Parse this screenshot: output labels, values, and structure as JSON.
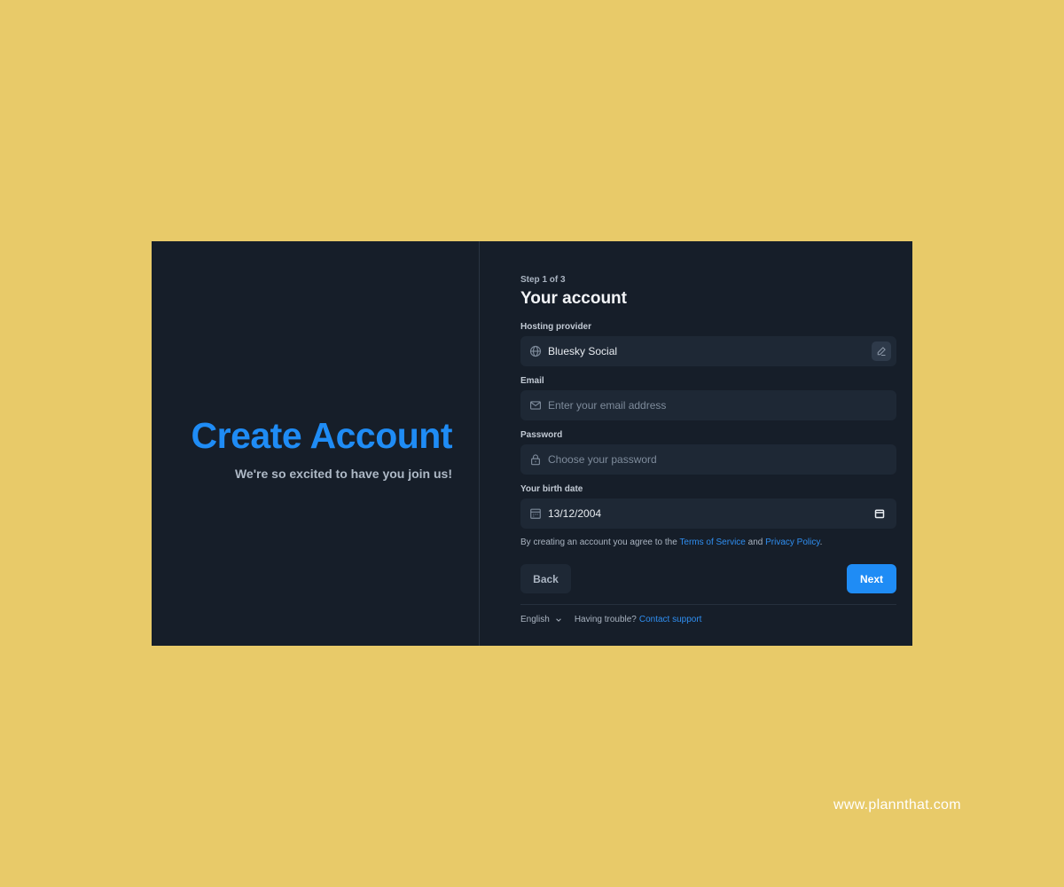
{
  "hero": {
    "title": "Create Account",
    "subtitle": "We're so excited to have you join us!"
  },
  "form": {
    "step": "Step 1 of 3",
    "title": "Your account",
    "hosting_provider": {
      "label": "Hosting provider",
      "value": "Bluesky Social",
      "icon": "globe-icon",
      "action_icon": "pencil-icon"
    },
    "email": {
      "label": "Email",
      "placeholder": "Enter your email address",
      "icon": "envelope-icon"
    },
    "password": {
      "label": "Password",
      "placeholder": "Choose your password",
      "icon": "lock-icon"
    },
    "birth_date": {
      "label": "Your birth date",
      "value": "13/12/2004",
      "icon": "calendar-icon"
    },
    "terms": {
      "prefix": "By creating an account you agree to the ",
      "tos_link": "Terms of Service",
      "and": " and ",
      "privacy_link": "Privacy Policy",
      "suffix": "."
    },
    "back_label": "Back",
    "next_label": "Next"
  },
  "footer": {
    "language": "English",
    "trouble_text": "Having trouble?",
    "support_link": "Contact support"
  },
  "watermark": "www.plannthat.com",
  "colors": {
    "background": "#e8ca69",
    "card": "#161e29",
    "accent": "#1f8cf5",
    "input": "#1e2835"
  }
}
